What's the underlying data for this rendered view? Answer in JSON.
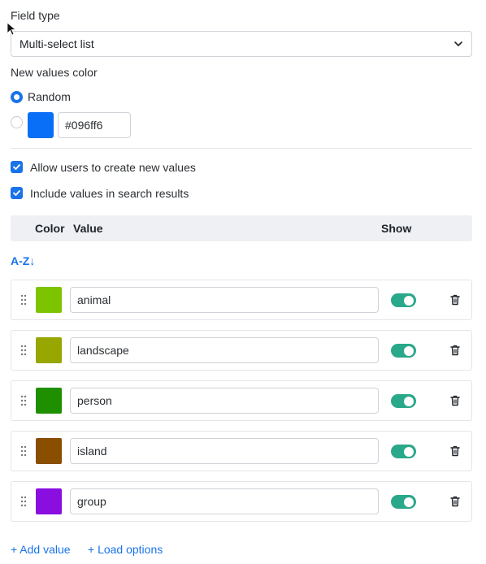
{
  "field_type": {
    "label": "Field type",
    "selected": "Multi-select list"
  },
  "new_values_color": {
    "label": "New values color",
    "random_label": "Random",
    "custom_hex": "#096ff6",
    "custom_color": "#096ff6",
    "selected_option": "random"
  },
  "options": {
    "allow_create_label": "Allow users to create new values",
    "allow_create_checked": true,
    "include_search_label": "Include values in search results",
    "include_search_checked": true
  },
  "table": {
    "headers": {
      "color": "Color",
      "value": "Value",
      "show": "Show"
    },
    "sort_label": "A-Z↓",
    "rows": [
      {
        "value": "animal",
        "color": "#7dc400",
        "show": true
      },
      {
        "value": "landscape",
        "color": "#98a600",
        "show": true
      },
      {
        "value": "person",
        "color": "#1e9000",
        "show": true
      },
      {
        "value": "island",
        "color": "#8a4e00",
        "show": true
      },
      {
        "value": "group",
        "color": "#8a0ee0",
        "show": true
      }
    ]
  },
  "actions": {
    "add_value": "+ Add value",
    "load_options": "+ Load options"
  },
  "icons": [
    "chevron-down-icon",
    "drag-handle-icon",
    "trash-icon",
    "check-icon",
    "mouse-cursor-icon"
  ],
  "colors": {
    "accent": "#1a73e8",
    "toggle_on": "#2aa88a"
  }
}
